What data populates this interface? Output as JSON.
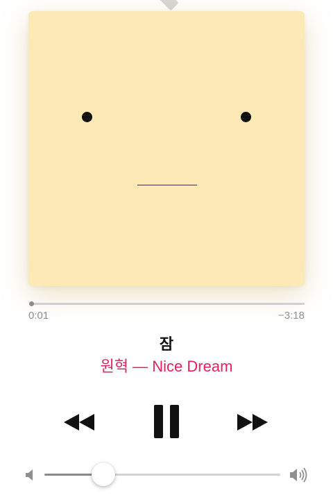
{
  "player": {
    "elapsed": "0:01",
    "remaining": "−3:18",
    "progress": 0.005,
    "title": "잠",
    "artist_album": "원혁 — Nice Dream",
    "volume": 0.25
  },
  "icons": {
    "rewind": "rewind-icon",
    "pause": "pause-icon",
    "forward": "fast-forward-icon",
    "volume_low": "speaker-low-icon",
    "volume_high": "speaker-high-icon"
  },
  "colors": {
    "accent": "#e0245e",
    "artwork_bg": "#fde9b5"
  }
}
